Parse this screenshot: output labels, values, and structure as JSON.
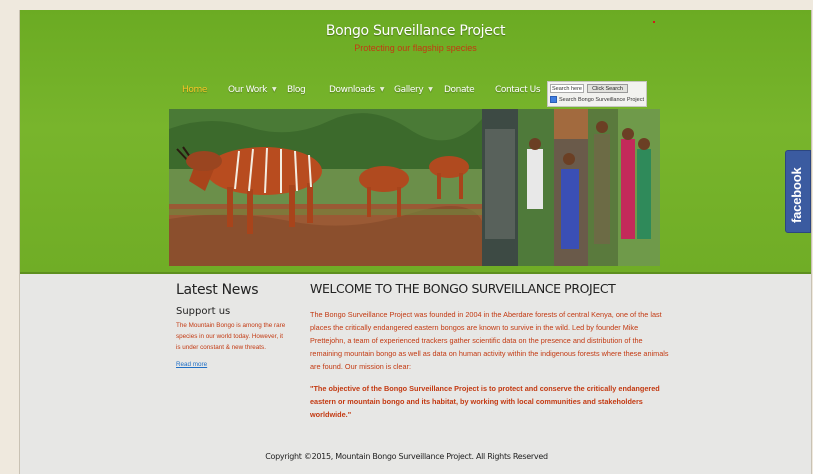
{
  "site": {
    "title": "Bongo Surveillance Project",
    "tagline": "Protecting our flagship species"
  },
  "nav": {
    "items": [
      {
        "label": "Home",
        "active": true,
        "dropdown": false
      },
      {
        "label": "Our Work",
        "active": false,
        "dropdown": true
      },
      {
        "label": "Blog",
        "active": false,
        "dropdown": false
      },
      {
        "label": "Downloads",
        "active": false,
        "dropdown": true
      },
      {
        "label": "Gallery",
        "active": false,
        "dropdown": true
      },
      {
        "label": "Donate",
        "active": false,
        "dropdown": false
      },
      {
        "label": "Contact Us",
        "active": false,
        "dropdown": false
      }
    ]
  },
  "search": {
    "value": "Search here",
    "button_label": "Click Search",
    "checkbox_label": "Search Bongo Surveillance Project",
    "checked": true
  },
  "sidebar": {
    "title": "Latest News",
    "subtitle": "Support us",
    "text": "The Mountain Bongo is among the rare species in our world today. However, it is under constant & new threats.",
    "link_label": "Read more"
  },
  "content": {
    "title": "WELCOME TO THE BONGO SURVEILLANCE PROJECT",
    "body": "The Bongo Surveillance Project was founded in 2004 in the Aberdare forests of central Kenya, one of the last places the critically endangered eastern bongos are known to survive in the wild. Led by founder Mike Prettejohn, a team of experienced trackers gather scientific data on the presence and distribution of the remaining mountain bongo as well as data on human activity within the indigenous forests where these animals are found. Our mission is clear:",
    "quote": "\"The objective of the Bongo Surveillance Project is to protect and conserve the critically endangered eastern or mountain bongo and its habitat, by working with local communities and stakeholders worldwide.\""
  },
  "footer": {
    "text": "Copyright ©2015, Mountain Bongo Surveillance Project. All Rights Reserved"
  },
  "facebook": {
    "label": "facebook"
  },
  "colors": {
    "header_green": "#74b12a",
    "accent_red": "#c33a12",
    "nav_active": "#f7c427",
    "facebook_blue": "#3b5ba0"
  }
}
